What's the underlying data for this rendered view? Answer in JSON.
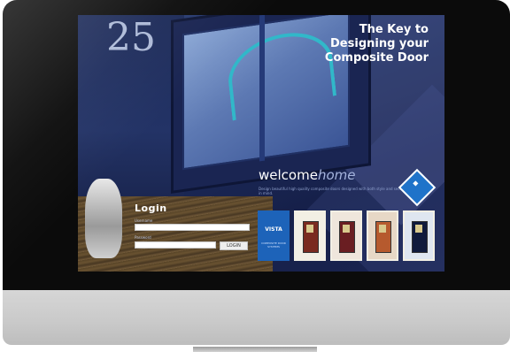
{
  "screen": {
    "tagline_lines": [
      "The Key to",
      "Designing your",
      "Composite Door"
    ],
    "house_number": "25",
    "brand": {
      "part1": "welcome",
      "part2": "home",
      "description": "Design beautiful high quality composite doors designed with both style and security in mind."
    },
    "logo_icon": "diamond-badge-icon",
    "login": {
      "title": "Login",
      "username_label": "Username",
      "password_label": "Password",
      "button_label": "LOGIN"
    },
    "thumbnails": [
      {
        "label": "VISTA",
        "sub": "COMPOSITE DOOR SYSTEMS",
        "type": "logo"
      },
      {
        "label": "",
        "sub": "",
        "type": "door",
        "door_color": "#7a2a1f",
        "frame_color": "#f2efe4"
      },
      {
        "label": "",
        "sub": "",
        "type": "door",
        "door_color": "#6a1e22",
        "frame_color": "#efe6dc"
      },
      {
        "label": "",
        "sub": "",
        "type": "door",
        "door_color": "#b65a2e",
        "frame_color": "#e7d8c6"
      },
      {
        "label": "",
        "sub": "",
        "type": "door",
        "door_color": "#101a3c",
        "frame_color": "#dfe6f0"
      }
    ]
  },
  "colors": {
    "bezel": "#0b0b0b",
    "chin": "#c9c9c9",
    "screen_bg": "#1d2c5b",
    "accent_blue": "#1d63b9",
    "window_arc": "#31b8c9"
  }
}
